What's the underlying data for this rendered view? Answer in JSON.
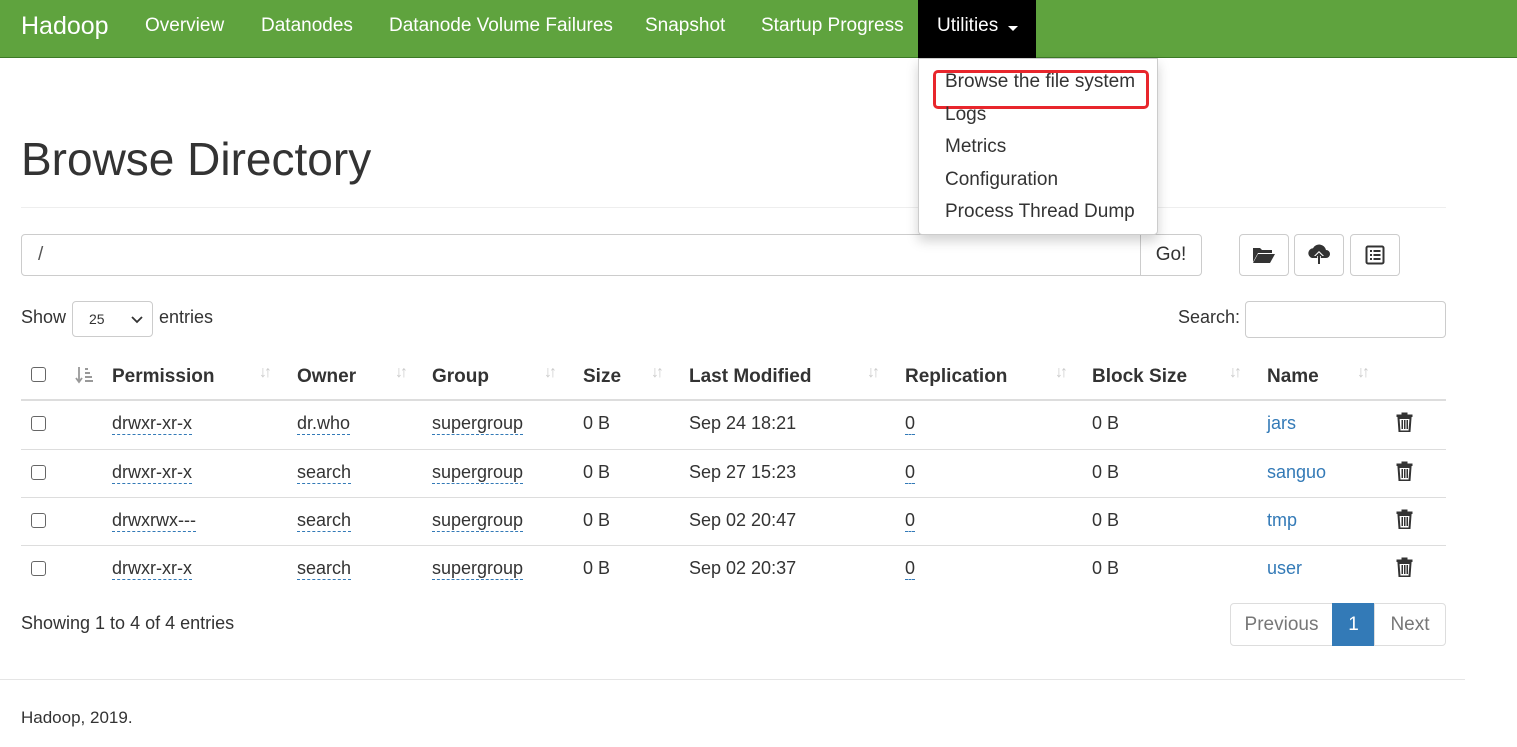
{
  "navbar": {
    "brand": "Hadoop",
    "items": [
      "Overview",
      "Datanodes",
      "Datanode Volume Failures",
      "Snapshot",
      "Startup Progress"
    ],
    "utilities_label": "Utilities",
    "dropdown": [
      "Browse the file system",
      "Logs",
      "Metrics",
      "Configuration",
      "Process Thread Dump"
    ],
    "highlight_color": "#e8262c",
    "bg_color": "#5fa33e"
  },
  "page": {
    "title": "Browse Directory",
    "path_value": "/",
    "go_label": "Go!"
  },
  "toolbar_icons": [
    "folder-open-icon",
    "cloud-upload-icon",
    "list-alt-icon"
  ],
  "table_controls": {
    "show_label": "Show",
    "entries_value": "25",
    "entries_label": "entries",
    "search_label": "Search:"
  },
  "table": {
    "headers": [
      "Permission",
      "Owner",
      "Group",
      "Size",
      "Last Modified",
      "Replication",
      "Block Size",
      "Name"
    ],
    "rows": [
      {
        "permission": "drwxr-xr-x",
        "owner": "dr.who",
        "group": "supergroup",
        "size": "0 B",
        "modified": "Sep 24 18:21",
        "replication": "0",
        "block_size": "0 B",
        "name": "jars"
      },
      {
        "permission": "drwxr-xr-x",
        "owner": "search",
        "group": "supergroup",
        "size": "0 B",
        "modified": "Sep 27 15:23",
        "replication": "0",
        "block_size": "0 B",
        "name": "sanguo"
      },
      {
        "permission": "drwxrwx---",
        "owner": "search",
        "group": "supergroup",
        "size": "0 B",
        "modified": "Sep 02 20:47",
        "replication": "0",
        "block_size": "0 B",
        "name": "tmp"
      },
      {
        "permission": "drwxr-xr-x",
        "owner": "search",
        "group": "supergroup",
        "size": "0 B",
        "modified": "Sep 02 20:37",
        "replication": "0",
        "block_size": "0 B",
        "name": "user"
      }
    ]
  },
  "pagination": {
    "info": "Showing 1 to 4 of 4 entries",
    "previous": "Previous",
    "current": "1",
    "next": "Next"
  },
  "footer": {
    "text": "Hadoop, 2019."
  }
}
